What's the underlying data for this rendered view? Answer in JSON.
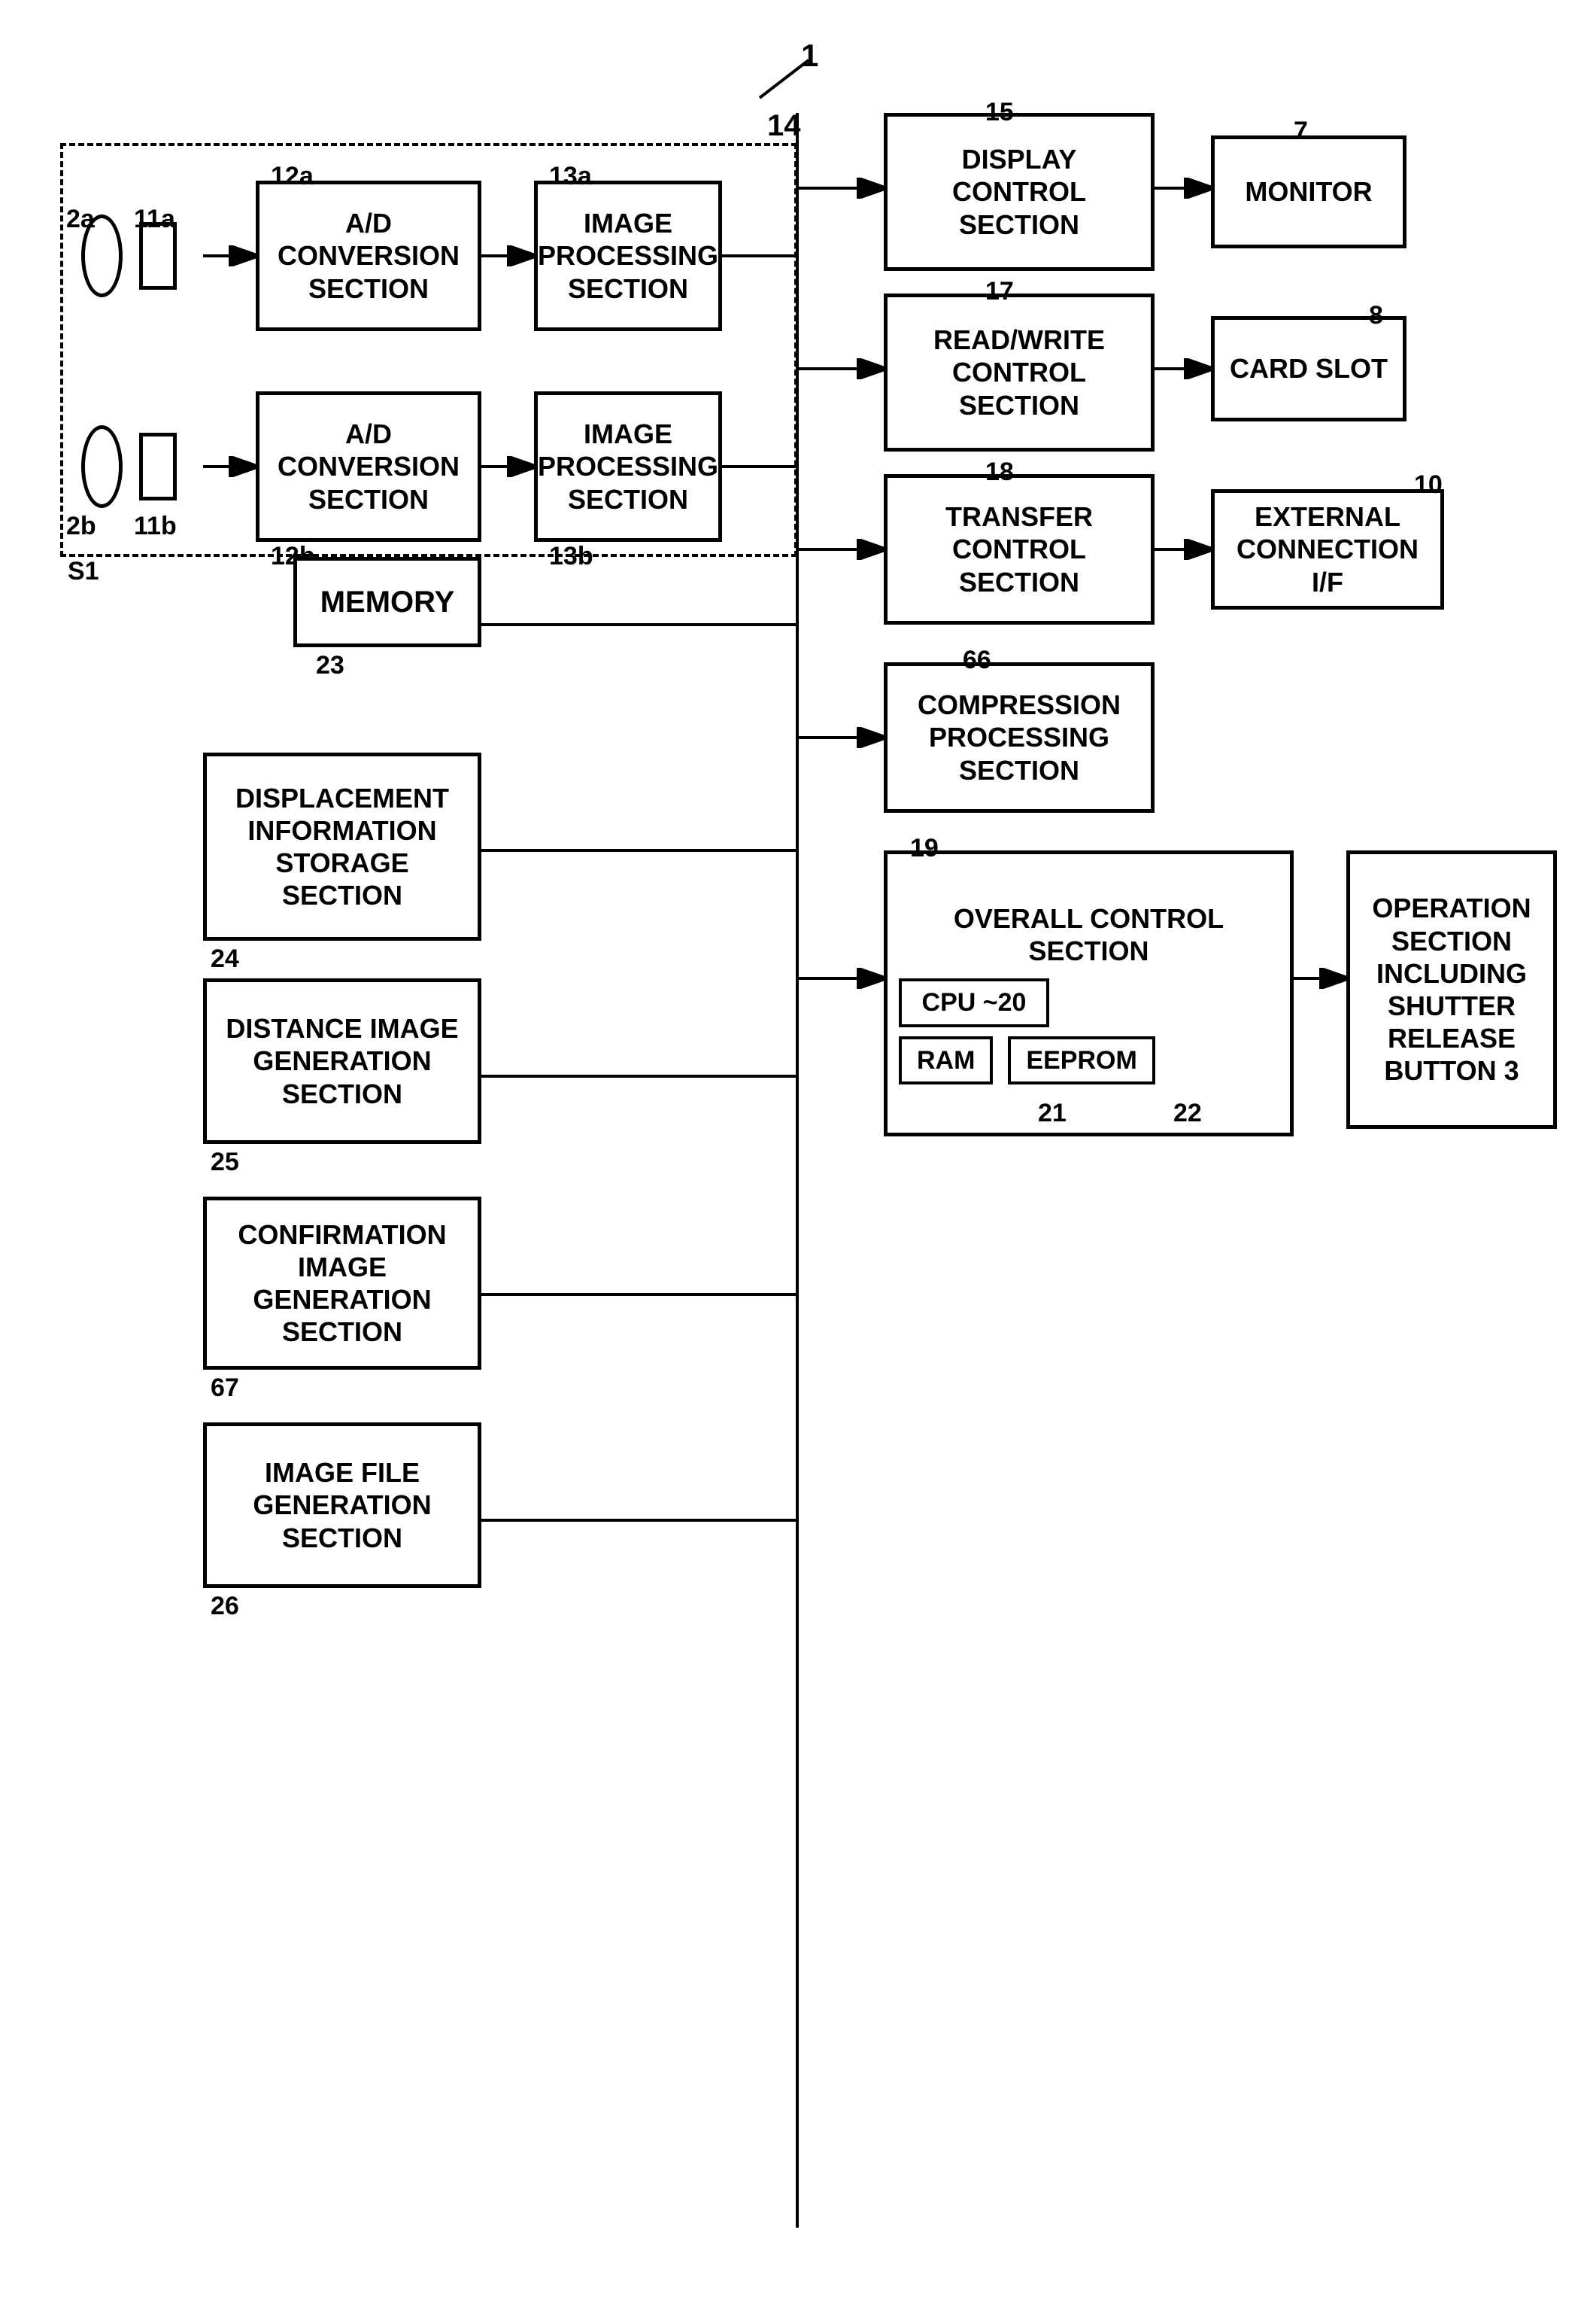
{
  "diagram": {
    "title_label": "1",
    "blocks": {
      "ad_conversion_top": {
        "label": "A/D\nCONVERSION\nSECTION",
        "num": "12a"
      },
      "image_processing_top": {
        "label": "IMAGE\nPROCESSING\nSECTION",
        "num": "13a"
      },
      "ad_conversion_bot": {
        "label": "A/D\nCONVERSION\nSECTION",
        "num": "12b"
      },
      "image_processing_bot": {
        "label": "IMAGE\nPROCESSING\nSECTION",
        "num": "13b"
      },
      "memory": {
        "label": "MEMORY",
        "num": "23"
      },
      "display_control": {
        "label": "DISPLAY\nCONTROL\nSECTION",
        "num": "15"
      },
      "monitor": {
        "label": "MONITOR",
        "num": "7"
      },
      "read_write": {
        "label": "READ/WRITE\nCONTROL\nSECTION",
        "num": "17"
      },
      "card_slot": {
        "label": "CARD SLOT",
        "num": "8"
      },
      "transfer_control": {
        "label": "TRANSFER\nCONTROL\nSECTION",
        "num": "18"
      },
      "external_connection": {
        "label": "EXTERNAL\nCONNECTION I/F",
        "num": "10"
      },
      "compression": {
        "label": "COMPRESSION\nPROCESSING\nSECTION",
        "num": "66"
      },
      "overall_control": {
        "label": "OVERALL CONTROL\nSECTION",
        "num": "19"
      },
      "cpu": {
        "label": "CPU",
        "num": "20"
      },
      "ram": {
        "label": "RAM",
        "num": "21"
      },
      "eeprom": {
        "label": "EEPROM",
        "num": "22"
      },
      "operation_section": {
        "label": "OPERATION\nSECTION\nINCLUDING\nSHUTTER\nRELEASE\nBUTTON 3",
        "num": ""
      },
      "displacement_info": {
        "label": "DISPLACEMENT\nINFORMATION\nSTORAGE SECTION",
        "num": "24"
      },
      "distance_image": {
        "label": "DISTANCE IMAGE\nGENERATION\nSECTION",
        "num": "25"
      },
      "confirmation_image": {
        "label": "CONFIRMATION\nIMAGE GENERATION\nSECTION",
        "num": "67"
      },
      "image_file": {
        "label": "IMAGE FILE\nGENERATION\nSECTION",
        "num": "26"
      }
    },
    "lens_labels": {
      "top_lens": "2a",
      "top_sensor": "11a",
      "bot_lens": "2b",
      "bot_sensor": "11b",
      "s1": "S1"
    }
  }
}
